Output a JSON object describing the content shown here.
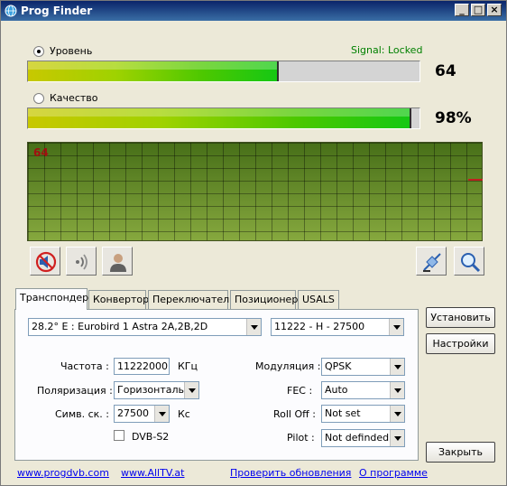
{
  "window": {
    "title": "Prog Finder"
  },
  "signal": {
    "level_label": "Уровень",
    "level_selected": true,
    "quality_label": "Качество",
    "quality_selected": false,
    "status": "Signal: Locked",
    "level_value": "64",
    "level_fraction": 0.64,
    "quality_value": "98%",
    "quality_fraction": 0.98
  },
  "graph": {
    "value": "64"
  },
  "toolbar": {
    "mute_icon": "mute-speaker-icon",
    "sound_icon": "sound-waves-icon",
    "user_icon": "user-icon",
    "satellite_icon": "satellite-icon",
    "search_icon": "magnifier-icon"
  },
  "tabs": [
    {
      "label": "Транспондер",
      "active": true
    },
    {
      "label": "Конвертор",
      "active": false
    },
    {
      "label": "Переключатель",
      "active": false
    },
    {
      "label": "Позиционер",
      "active": false
    },
    {
      "label": "USALS",
      "active": false
    }
  ],
  "transponder": {
    "satellite": "28.2° E : Eurobird 1   Astra 2A,2B,2D",
    "transponder": "11222 - H - 27500",
    "frequency_label": "Частота :",
    "frequency_value": "11222000",
    "frequency_unit": "КГц",
    "polarization_label": "Поляризация :",
    "polarization_value": "Горизонтальн",
    "symbol_rate_label": "Симв. ск. :",
    "symbol_rate_value": "27500",
    "symbol_rate_unit": "Кс",
    "dvbs2_label": "DVB-S2",
    "dvbs2_checked": false,
    "modulation_label": "Модуляция :",
    "modulation_value": "QPSK",
    "fec_label": "FEC :",
    "fec_value": "Auto",
    "rolloff_label": "Roll Off :",
    "rolloff_value": "Not set",
    "pilot_label": "Pilot :",
    "pilot_value": "Not definded"
  },
  "buttons": {
    "install": "Установить",
    "settings": "Настройки",
    "close": "Закрыть"
  },
  "links": {
    "progdvb": "www.progdvb.com",
    "alltv": "www.AllTV.at",
    "check_updates": "Проверить обновления",
    "about": "О программе"
  },
  "colors": {
    "signal_status": "#008000",
    "graph_value": "#a01010"
  }
}
